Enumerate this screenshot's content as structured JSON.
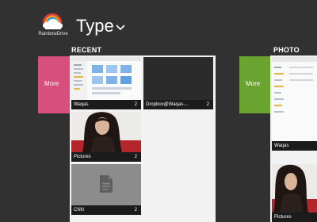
{
  "app": {
    "logo_text": "RainbowDrive",
    "title": "Type",
    "title_chevron_icon": "chevron-down-icon"
  },
  "sections": [
    {
      "label": "RECENT",
      "more_label": "More",
      "more_color": "#d64f7d",
      "tiles": [
        {
          "name": "Waqas",
          "count": "2",
          "kind": "screenshot"
        },
        {
          "name": "Dropbox@Waqas-...",
          "count": "2",
          "kind": "dark"
        },
        {
          "name": "Pictures",
          "count": "2",
          "kind": "photo"
        },
        {
          "name": "CNN",
          "count": "2",
          "kind": "document",
          "icon": "document-icon"
        }
      ]
    },
    {
      "label": "PHOTO",
      "more_label": "More",
      "more_color": "#6aa32f",
      "tiles": [
        {
          "name": "Waqas",
          "count": "",
          "kind": "screenshot"
        },
        {
          "name": "Pictures",
          "count": "",
          "kind": "photo"
        }
      ]
    }
  ],
  "colors": {
    "background": "#313131",
    "panel": "#f2f2f2",
    "tile_bar": "#1b1b1b"
  }
}
